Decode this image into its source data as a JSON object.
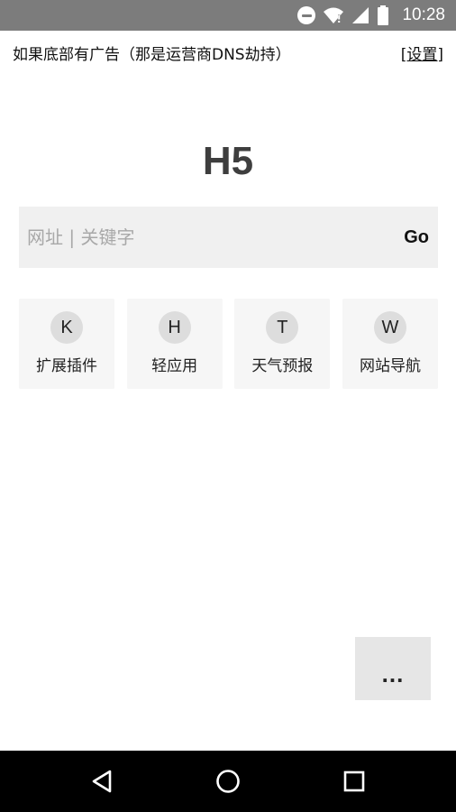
{
  "status_bar": {
    "time": "10:28",
    "icons": [
      "do-not-disturb-icon",
      "wifi-icon",
      "signal-icon",
      "battery-icon"
    ]
  },
  "notice": {
    "text": "如果底部有广告（那是运营商DNS劫持）",
    "settings_label": "[设置]"
  },
  "title": "H5",
  "search": {
    "placeholder": "网址 | 关键字",
    "value": "",
    "go_label": "Go"
  },
  "shortcuts": [
    {
      "letter": "K",
      "label": "扩展插件"
    },
    {
      "letter": "H",
      "label": "轻应用"
    },
    {
      "letter": "T",
      "label": "天气预报"
    },
    {
      "letter": "W",
      "label": "网站导航"
    }
  ],
  "more_label": "...",
  "nav": [
    "back-icon",
    "home-icon",
    "recents-icon"
  ],
  "colors": {
    "status_bar": "#7c7c7c",
    "search_bg": "#f0f0f0",
    "tile_bg": "#f6f6f6",
    "badge_bg": "#dddddd",
    "more_bg": "#e6e6e6",
    "nav_bar": "#000000"
  }
}
